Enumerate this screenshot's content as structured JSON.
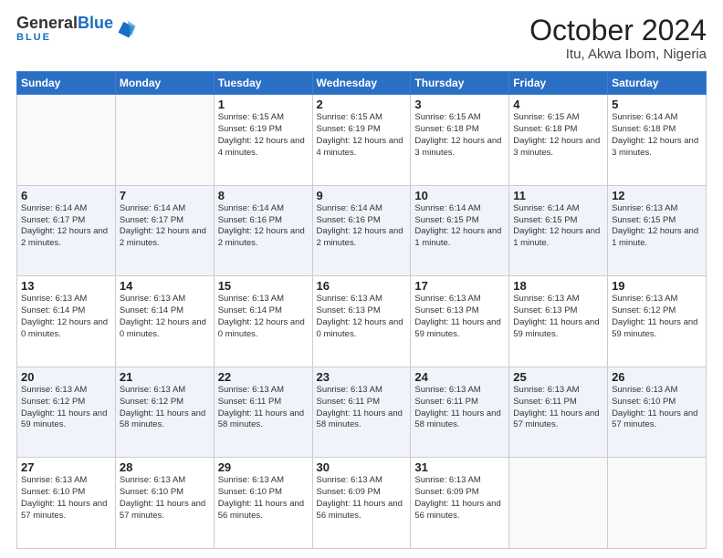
{
  "header": {
    "logo_general": "General",
    "logo_blue": "Blue",
    "title": "October 2024",
    "subtitle": "Itu, Akwa Ibom, Nigeria"
  },
  "weekdays": [
    "Sunday",
    "Monday",
    "Tuesday",
    "Wednesday",
    "Thursday",
    "Friday",
    "Saturday"
  ],
  "weeks": [
    [
      {
        "day": "",
        "info": ""
      },
      {
        "day": "",
        "info": ""
      },
      {
        "day": "1",
        "info": "Sunrise: 6:15 AM\nSunset: 6:19 PM\nDaylight: 12 hours and 4 minutes."
      },
      {
        "day": "2",
        "info": "Sunrise: 6:15 AM\nSunset: 6:19 PM\nDaylight: 12 hours and 4 minutes."
      },
      {
        "day": "3",
        "info": "Sunrise: 6:15 AM\nSunset: 6:18 PM\nDaylight: 12 hours and 3 minutes."
      },
      {
        "day": "4",
        "info": "Sunrise: 6:15 AM\nSunset: 6:18 PM\nDaylight: 12 hours and 3 minutes."
      },
      {
        "day": "5",
        "info": "Sunrise: 6:14 AM\nSunset: 6:18 PM\nDaylight: 12 hours and 3 minutes."
      }
    ],
    [
      {
        "day": "6",
        "info": "Sunrise: 6:14 AM\nSunset: 6:17 PM\nDaylight: 12 hours and 2 minutes."
      },
      {
        "day": "7",
        "info": "Sunrise: 6:14 AM\nSunset: 6:17 PM\nDaylight: 12 hours and 2 minutes."
      },
      {
        "day": "8",
        "info": "Sunrise: 6:14 AM\nSunset: 6:16 PM\nDaylight: 12 hours and 2 minutes."
      },
      {
        "day": "9",
        "info": "Sunrise: 6:14 AM\nSunset: 6:16 PM\nDaylight: 12 hours and 2 minutes."
      },
      {
        "day": "10",
        "info": "Sunrise: 6:14 AM\nSunset: 6:15 PM\nDaylight: 12 hours and 1 minute."
      },
      {
        "day": "11",
        "info": "Sunrise: 6:14 AM\nSunset: 6:15 PM\nDaylight: 12 hours and 1 minute."
      },
      {
        "day": "12",
        "info": "Sunrise: 6:13 AM\nSunset: 6:15 PM\nDaylight: 12 hours and 1 minute."
      }
    ],
    [
      {
        "day": "13",
        "info": "Sunrise: 6:13 AM\nSunset: 6:14 PM\nDaylight: 12 hours and 0 minutes."
      },
      {
        "day": "14",
        "info": "Sunrise: 6:13 AM\nSunset: 6:14 PM\nDaylight: 12 hours and 0 minutes."
      },
      {
        "day": "15",
        "info": "Sunrise: 6:13 AM\nSunset: 6:14 PM\nDaylight: 12 hours and 0 minutes."
      },
      {
        "day": "16",
        "info": "Sunrise: 6:13 AM\nSunset: 6:13 PM\nDaylight: 12 hours and 0 minutes."
      },
      {
        "day": "17",
        "info": "Sunrise: 6:13 AM\nSunset: 6:13 PM\nDaylight: 11 hours and 59 minutes."
      },
      {
        "day": "18",
        "info": "Sunrise: 6:13 AM\nSunset: 6:13 PM\nDaylight: 11 hours and 59 minutes."
      },
      {
        "day": "19",
        "info": "Sunrise: 6:13 AM\nSunset: 6:12 PM\nDaylight: 11 hours and 59 minutes."
      }
    ],
    [
      {
        "day": "20",
        "info": "Sunrise: 6:13 AM\nSunset: 6:12 PM\nDaylight: 11 hours and 59 minutes."
      },
      {
        "day": "21",
        "info": "Sunrise: 6:13 AM\nSunset: 6:12 PM\nDaylight: 11 hours and 58 minutes."
      },
      {
        "day": "22",
        "info": "Sunrise: 6:13 AM\nSunset: 6:11 PM\nDaylight: 11 hours and 58 minutes."
      },
      {
        "day": "23",
        "info": "Sunrise: 6:13 AM\nSunset: 6:11 PM\nDaylight: 11 hours and 58 minutes."
      },
      {
        "day": "24",
        "info": "Sunrise: 6:13 AM\nSunset: 6:11 PM\nDaylight: 11 hours and 58 minutes."
      },
      {
        "day": "25",
        "info": "Sunrise: 6:13 AM\nSunset: 6:11 PM\nDaylight: 11 hours and 57 minutes."
      },
      {
        "day": "26",
        "info": "Sunrise: 6:13 AM\nSunset: 6:10 PM\nDaylight: 11 hours and 57 minutes."
      }
    ],
    [
      {
        "day": "27",
        "info": "Sunrise: 6:13 AM\nSunset: 6:10 PM\nDaylight: 11 hours and 57 minutes."
      },
      {
        "day": "28",
        "info": "Sunrise: 6:13 AM\nSunset: 6:10 PM\nDaylight: 11 hours and 57 minutes."
      },
      {
        "day": "29",
        "info": "Sunrise: 6:13 AM\nSunset: 6:10 PM\nDaylight: 11 hours and 56 minutes."
      },
      {
        "day": "30",
        "info": "Sunrise: 6:13 AM\nSunset: 6:09 PM\nDaylight: 11 hours and 56 minutes."
      },
      {
        "day": "31",
        "info": "Sunrise: 6:13 AM\nSunset: 6:09 PM\nDaylight: 11 hours and 56 minutes."
      },
      {
        "day": "",
        "info": ""
      },
      {
        "day": "",
        "info": ""
      }
    ]
  ]
}
